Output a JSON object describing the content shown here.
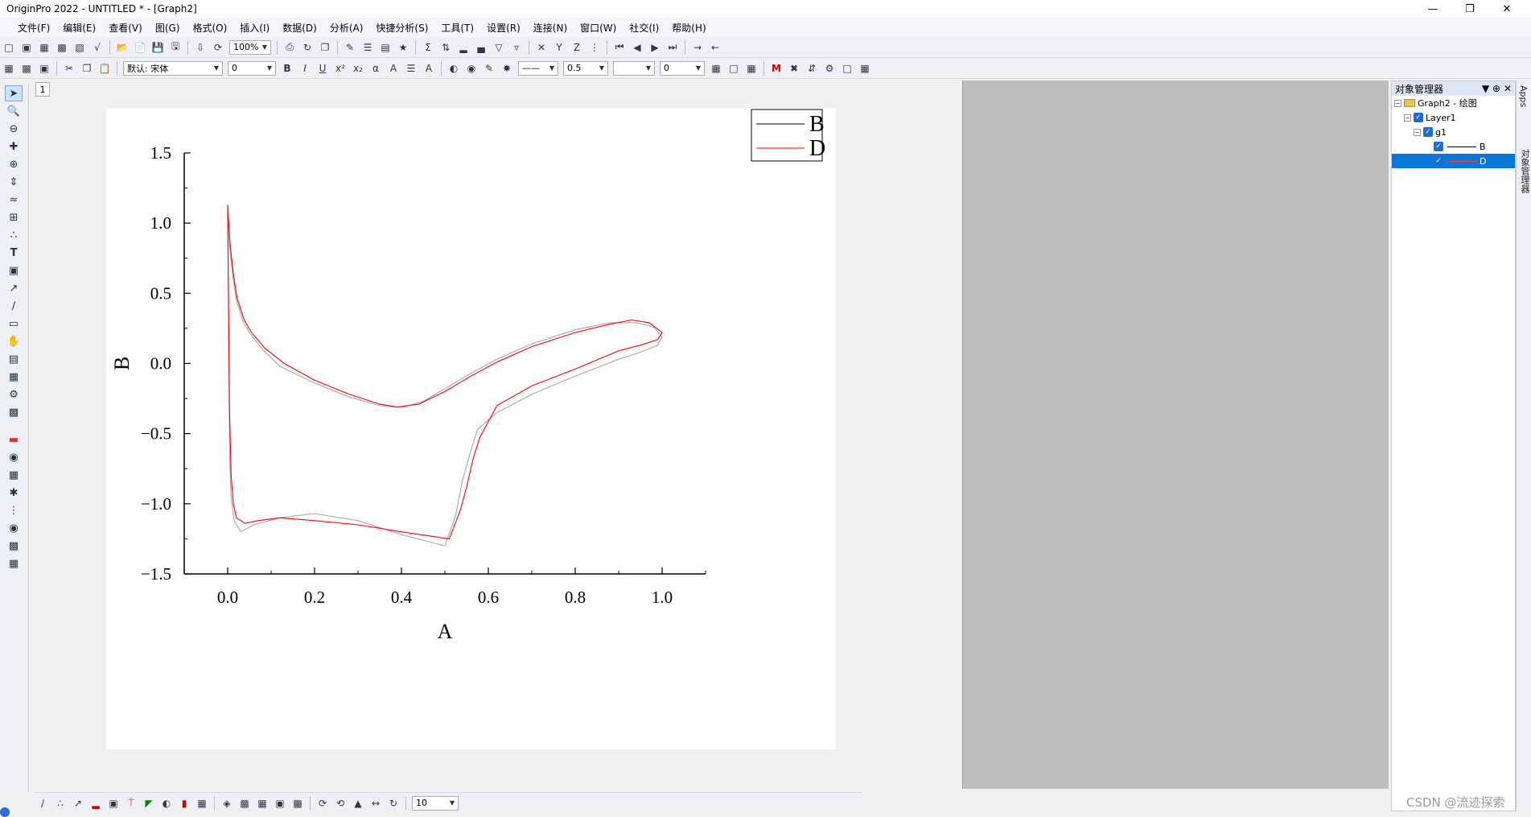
{
  "window": {
    "title": "OriginPro 2022 - UNTITLED * - [Graph2]",
    "minimize_icon": "minimize-icon",
    "restore_icon": "restore-icon",
    "close_icon": "close-icon"
  },
  "menu": {
    "items": [
      "文件(F)",
      "编辑(E)",
      "查看(V)",
      "图(G)",
      "格式(O)",
      "插入(I)",
      "数据(D)",
      "分析(A)",
      "快捷分析(S)",
      "工具(T)",
      "设置(R)",
      "连接(N)",
      "窗口(W)",
      "社交(I)",
      "帮助(H)"
    ]
  },
  "toolbar1": {
    "zoom": "100%"
  },
  "toolbar2": {
    "font_name": "默认: 宋体",
    "font_size": "0",
    "line_width": "0.5",
    "pattern_value": "0",
    "bold": "B",
    "italic": "I",
    "underline": "U"
  },
  "workspace": {
    "layer_tab": "1"
  },
  "bottom_toolbar": {
    "value": "10"
  },
  "object_manager": {
    "title": "对象管理器",
    "tree": [
      {
        "label": "Graph2 - 绘图",
        "level": 0
      },
      {
        "label": "Layer1",
        "level": 1
      },
      {
        "label": "g1",
        "level": 2
      },
      {
        "label": "B",
        "level": 3
      },
      {
        "label": "D",
        "level": 3,
        "selected": true
      }
    ]
  },
  "right_tabs": {
    "apps": "Apps",
    "object_manager_tab": "对象管理器"
  },
  "watermark": "CSDN @流迹探索",
  "chart_data": {
    "type": "line",
    "xlabel": "A",
    "ylabel": "B",
    "xlim": [
      -0.1,
      1.1
    ],
    "ylim": [
      -1.5,
      1.5
    ],
    "xticks": [
      0.0,
      0.2,
      0.4,
      0.6,
      0.8,
      1.0
    ],
    "xtick_labels": [
      "0.0",
      "0.2",
      "0.4",
      "0.6",
      "0.8",
      "1.0"
    ],
    "yticks": [
      1.5,
      1.0,
      0.5,
      0.0,
      -0.5,
      -1.0,
      -1.5
    ],
    "ytick_labels": [
      "1.5",
      "1.0",
      "0.5",
      "0.0",
      "−0.5",
      "−1.0",
      "−1.5"
    ],
    "grid": false,
    "legend_position": "top-right",
    "series": [
      {
        "name": "B",
        "color": "#000000",
        "x": [
          0.0,
          0.002,
          0.005,
          0.012,
          0.02,
          0.035,
          0.05,
          0.08,
          0.12,
          0.2,
          0.28,
          0.35,
          0.4,
          0.45,
          0.5,
          0.56,
          0.62,
          0.7,
          0.8,
          0.88,
          0.94,
          0.98,
          1.0,
          0.99,
          0.95,
          0.9,
          0.8,
          0.7,
          0.62,
          0.575,
          0.56,
          0.54,
          0.525,
          0.5,
          0.4,
          0.3,
          0.2,
          0.12,
          0.06,
          0.03,
          0.015,
          0.008,
          0.005,
          0.003,
          0.0
        ],
        "y": [
          1.12,
          1.0,
          0.82,
          0.62,
          0.45,
          0.3,
          0.22,
          0.1,
          -0.02,
          -0.14,
          -0.24,
          -0.3,
          -0.315,
          -0.27,
          -0.18,
          -0.07,
          0.03,
          0.14,
          0.24,
          0.29,
          0.29,
          0.26,
          0.19,
          0.13,
          0.08,
          0.03,
          -0.09,
          -0.22,
          -0.35,
          -0.47,
          -0.62,
          -0.84,
          -1.08,
          -1.3,
          -1.22,
          -1.12,
          -1.07,
          -1.1,
          -1.15,
          -1.2,
          -1.12,
          -0.96,
          -0.7,
          -0.2,
          1.12
        ]
      },
      {
        "name": "D",
        "color": "#ff0000",
        "x": [
          0.0,
          0.002,
          0.006,
          0.013,
          0.022,
          0.038,
          0.055,
          0.085,
          0.13,
          0.2,
          0.28,
          0.35,
          0.39,
          0.44,
          0.5,
          0.56,
          0.62,
          0.7,
          0.8,
          0.88,
          0.93,
          0.97,
          1.0,
          0.99,
          0.95,
          0.9,
          0.8,
          0.7,
          0.62,
          0.58,
          0.565,
          0.55,
          0.535,
          0.51,
          0.4,
          0.3,
          0.2,
          0.12,
          0.07,
          0.04,
          0.02,
          0.013,
          0.008,
          0.004,
          0.0
        ],
        "y": [
          1.13,
          1.02,
          0.84,
          0.64,
          0.46,
          0.31,
          0.22,
          0.11,
          0.0,
          -0.12,
          -0.22,
          -0.29,
          -0.31,
          -0.29,
          -0.2,
          -0.09,
          0.01,
          0.12,
          0.22,
          0.28,
          0.31,
          0.29,
          0.22,
          0.17,
          0.13,
          0.09,
          -0.04,
          -0.16,
          -0.3,
          -0.53,
          -0.68,
          -0.88,
          -1.05,
          -1.25,
          -1.2,
          -1.15,
          -1.12,
          -1.1,
          -1.12,
          -1.14,
          -1.1,
          -1.0,
          -0.8,
          -0.3,
          1.13
        ]
      }
    ]
  }
}
